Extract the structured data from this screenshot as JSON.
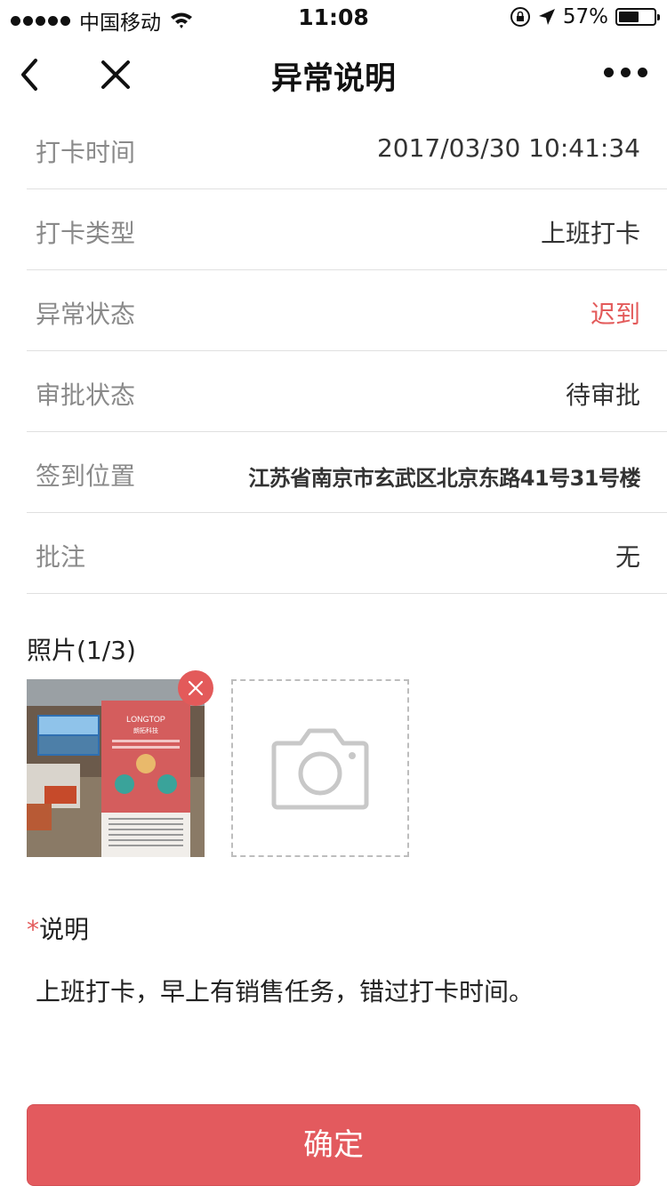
{
  "status_bar": {
    "carrier": "中国移动",
    "time": "11:08",
    "battery_percent": "57%",
    "battery_level": 0.57,
    "icons": [
      "signal-dots-icon",
      "wifi-icon",
      "orientation-lock-icon",
      "location-arrow-icon",
      "battery-icon"
    ]
  },
  "nav": {
    "title": "异常说明",
    "back_icon": "chevron-left-icon",
    "close_icon": "close-icon",
    "more_icon": "more-dots-icon"
  },
  "info": {
    "rows": [
      {
        "label": "打卡时间",
        "value": "2017/03/30 10:41:34"
      },
      {
        "label": "打卡类型",
        "value": "上班打卡"
      },
      {
        "label": "异常状态",
        "value": "迟到"
      },
      {
        "label": "审批状态",
        "value": "待审批"
      },
      {
        "label": "签到位置",
        "value": "江苏省南京市玄武区北京东路41号31号楼"
      },
      {
        "label": "批注",
        "value": "无"
      }
    ]
  },
  "photos": {
    "title": "照片(1/3)",
    "poster_brand": "LONGTOP",
    "poster_brand_cn": "朗拓科技",
    "remove_icon": "close-icon",
    "add_icon": "camera-icon"
  },
  "description": {
    "required_mark": "*",
    "label": "说明",
    "text": "上班打卡，早上有销售任务，错过打卡时间。"
  },
  "confirm_label": "确定",
  "colors": {
    "accent": "#e35a5e",
    "label_gray": "#8a8a8a",
    "divider": "#e0e0e0"
  }
}
